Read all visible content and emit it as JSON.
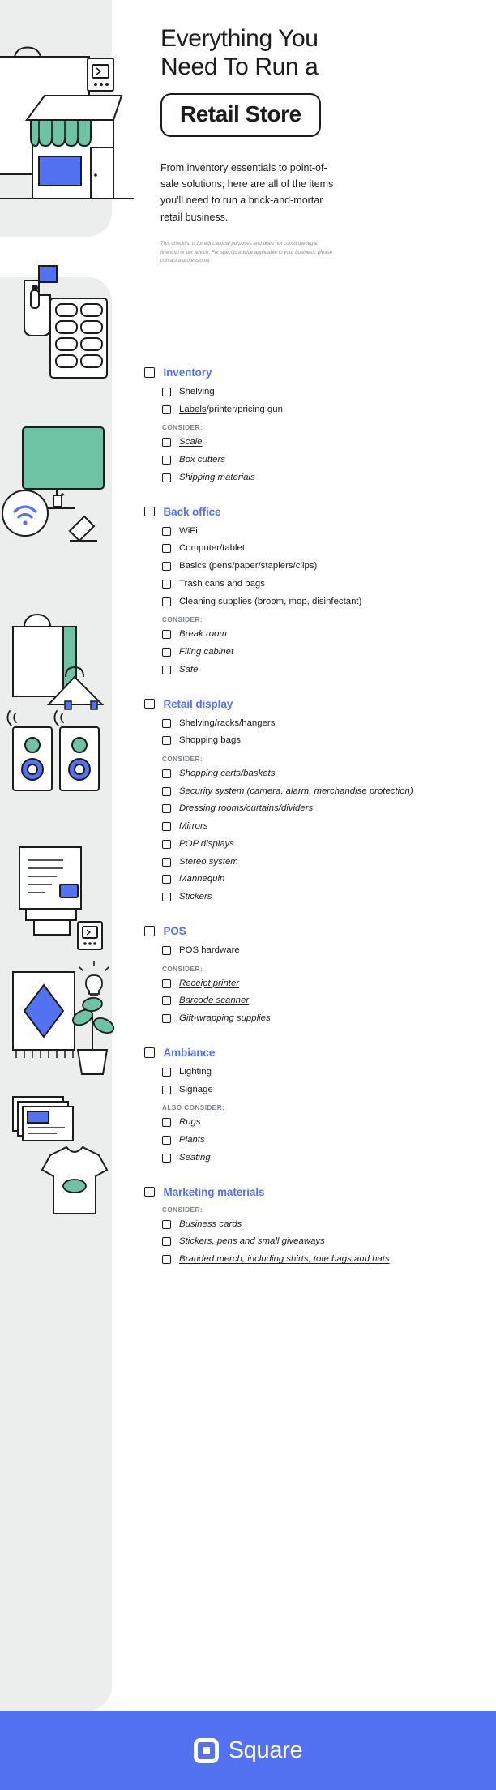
{
  "hero": {
    "title_line1": "Everything You",
    "title_line2": "Need To Run a",
    "pill_label": "Retail Store",
    "subtitle": "From inventory essentials to point-of-sale solutions, here are all of the items you'll need to run a brick-and-mortar retail business.",
    "disclaimer": "This checklist is for educational purposes and does not constitute legal, financial or tax advice. For specific advice applicable to your business, please contact a professional."
  },
  "colors": {
    "accent": "#5272f2",
    "ink": "#1c1c1c",
    "muted": "#7b8085",
    "rail": "#eceded",
    "teal": "#6ec3a5"
  },
  "sections": [
    {
      "title": "Inventory",
      "items": [
        {
          "label": "Shelving",
          "consider": false,
          "link": null
        },
        {
          "label": "Labels/printer/pricing gun",
          "consider": false,
          "link": "Labels"
        }
      ],
      "sub_label": "CONSIDER:",
      "sub_items": [
        {
          "label": "Scale",
          "consider": true,
          "link": "Scale"
        },
        {
          "label": "Box cutters",
          "consider": true,
          "link": null
        },
        {
          "label": "Shipping materials",
          "consider": true,
          "link": null
        }
      ]
    },
    {
      "title": "Back office",
      "items": [
        {
          "label": "WiFi",
          "consider": false,
          "link": null
        },
        {
          "label": "Computer/tablet",
          "consider": false,
          "link": null
        },
        {
          "label": "Basics (pens/paper/staplers/clips)",
          "consider": false,
          "link": null
        },
        {
          "label": "Trash cans and bags",
          "consider": false,
          "link": null
        },
        {
          "label": "Cleaning supplies (broom, mop, disinfectant)",
          "consider": false,
          "link": null
        }
      ],
      "sub_label": "CONSIDER:",
      "sub_items": [
        {
          "label": "Break room",
          "consider": true,
          "link": null
        },
        {
          "label": "Filing cabinet",
          "consider": true,
          "link": null
        },
        {
          "label": "Safe",
          "consider": true,
          "link": null
        }
      ]
    },
    {
      "title": "Retail display",
      "items": [
        {
          "label": "Shelving/racks/hangers",
          "consider": false,
          "link": null
        },
        {
          "label": "Shopping bags",
          "consider": false,
          "link": null
        }
      ],
      "sub_label": "CONSIDER:",
      "sub_items": [
        {
          "label": "Shopping carts/baskets",
          "consider": true,
          "link": null
        },
        {
          "label": "Security system (camera, alarm, merchandise protection)",
          "consider": true,
          "link": null
        },
        {
          "label": "Dressing rooms/curtains/dividers",
          "consider": true,
          "link": null
        },
        {
          "label": "Mirrors",
          "consider": true,
          "link": null
        },
        {
          "label": "POP displays",
          "consider": true,
          "link": null
        },
        {
          "label": "Stereo system",
          "consider": true,
          "link": null
        },
        {
          "label": "Mannequin",
          "consider": true,
          "link": null
        },
        {
          "label": "Stickers",
          "consider": true,
          "link": null
        }
      ]
    },
    {
      "title": "POS",
      "items": [
        {
          "label": "POS hardware",
          "consider": false,
          "link": null
        }
      ],
      "sub_label": "CONSIDER:",
      "sub_items": [
        {
          "label": "Receipt printer",
          "consider": true,
          "link": "Receipt printer"
        },
        {
          "label": "Barcode scanner",
          "consider": true,
          "link": "Barcode scanner"
        },
        {
          "label": "Gift-wrapping supplies",
          "consider": true,
          "link": null
        }
      ]
    },
    {
      "title": "Ambiance",
      "items": [
        {
          "label": "Lighting",
          "consider": false,
          "link": null
        },
        {
          "label": "Signage",
          "consider": false,
          "link": null
        }
      ],
      "sub_label": "ALSO CONSIDER:",
      "sub_items": [
        {
          "label": "Rugs",
          "consider": true,
          "link": null
        },
        {
          "label": "Plants",
          "consider": true,
          "link": null
        },
        {
          "label": "Seating",
          "consider": true,
          "link": null
        }
      ]
    },
    {
      "title": "Marketing materials",
      "items": [],
      "sub_label": "CONSIDER:",
      "sub_items": [
        {
          "label": "Business cards",
          "consider": true,
          "link": null
        },
        {
          "label": "Stickers, pens and small giveaways",
          "consider": true,
          "link": null
        },
        {
          "label": "Branded merch, including shirts, tote bags and hats",
          "consider": true,
          "link": "Branded merch, including shirts, tote bags and hats"
        }
      ]
    }
  ],
  "footer": {
    "brand": "Square",
    "logo_icon": "square-logo-icon"
  }
}
